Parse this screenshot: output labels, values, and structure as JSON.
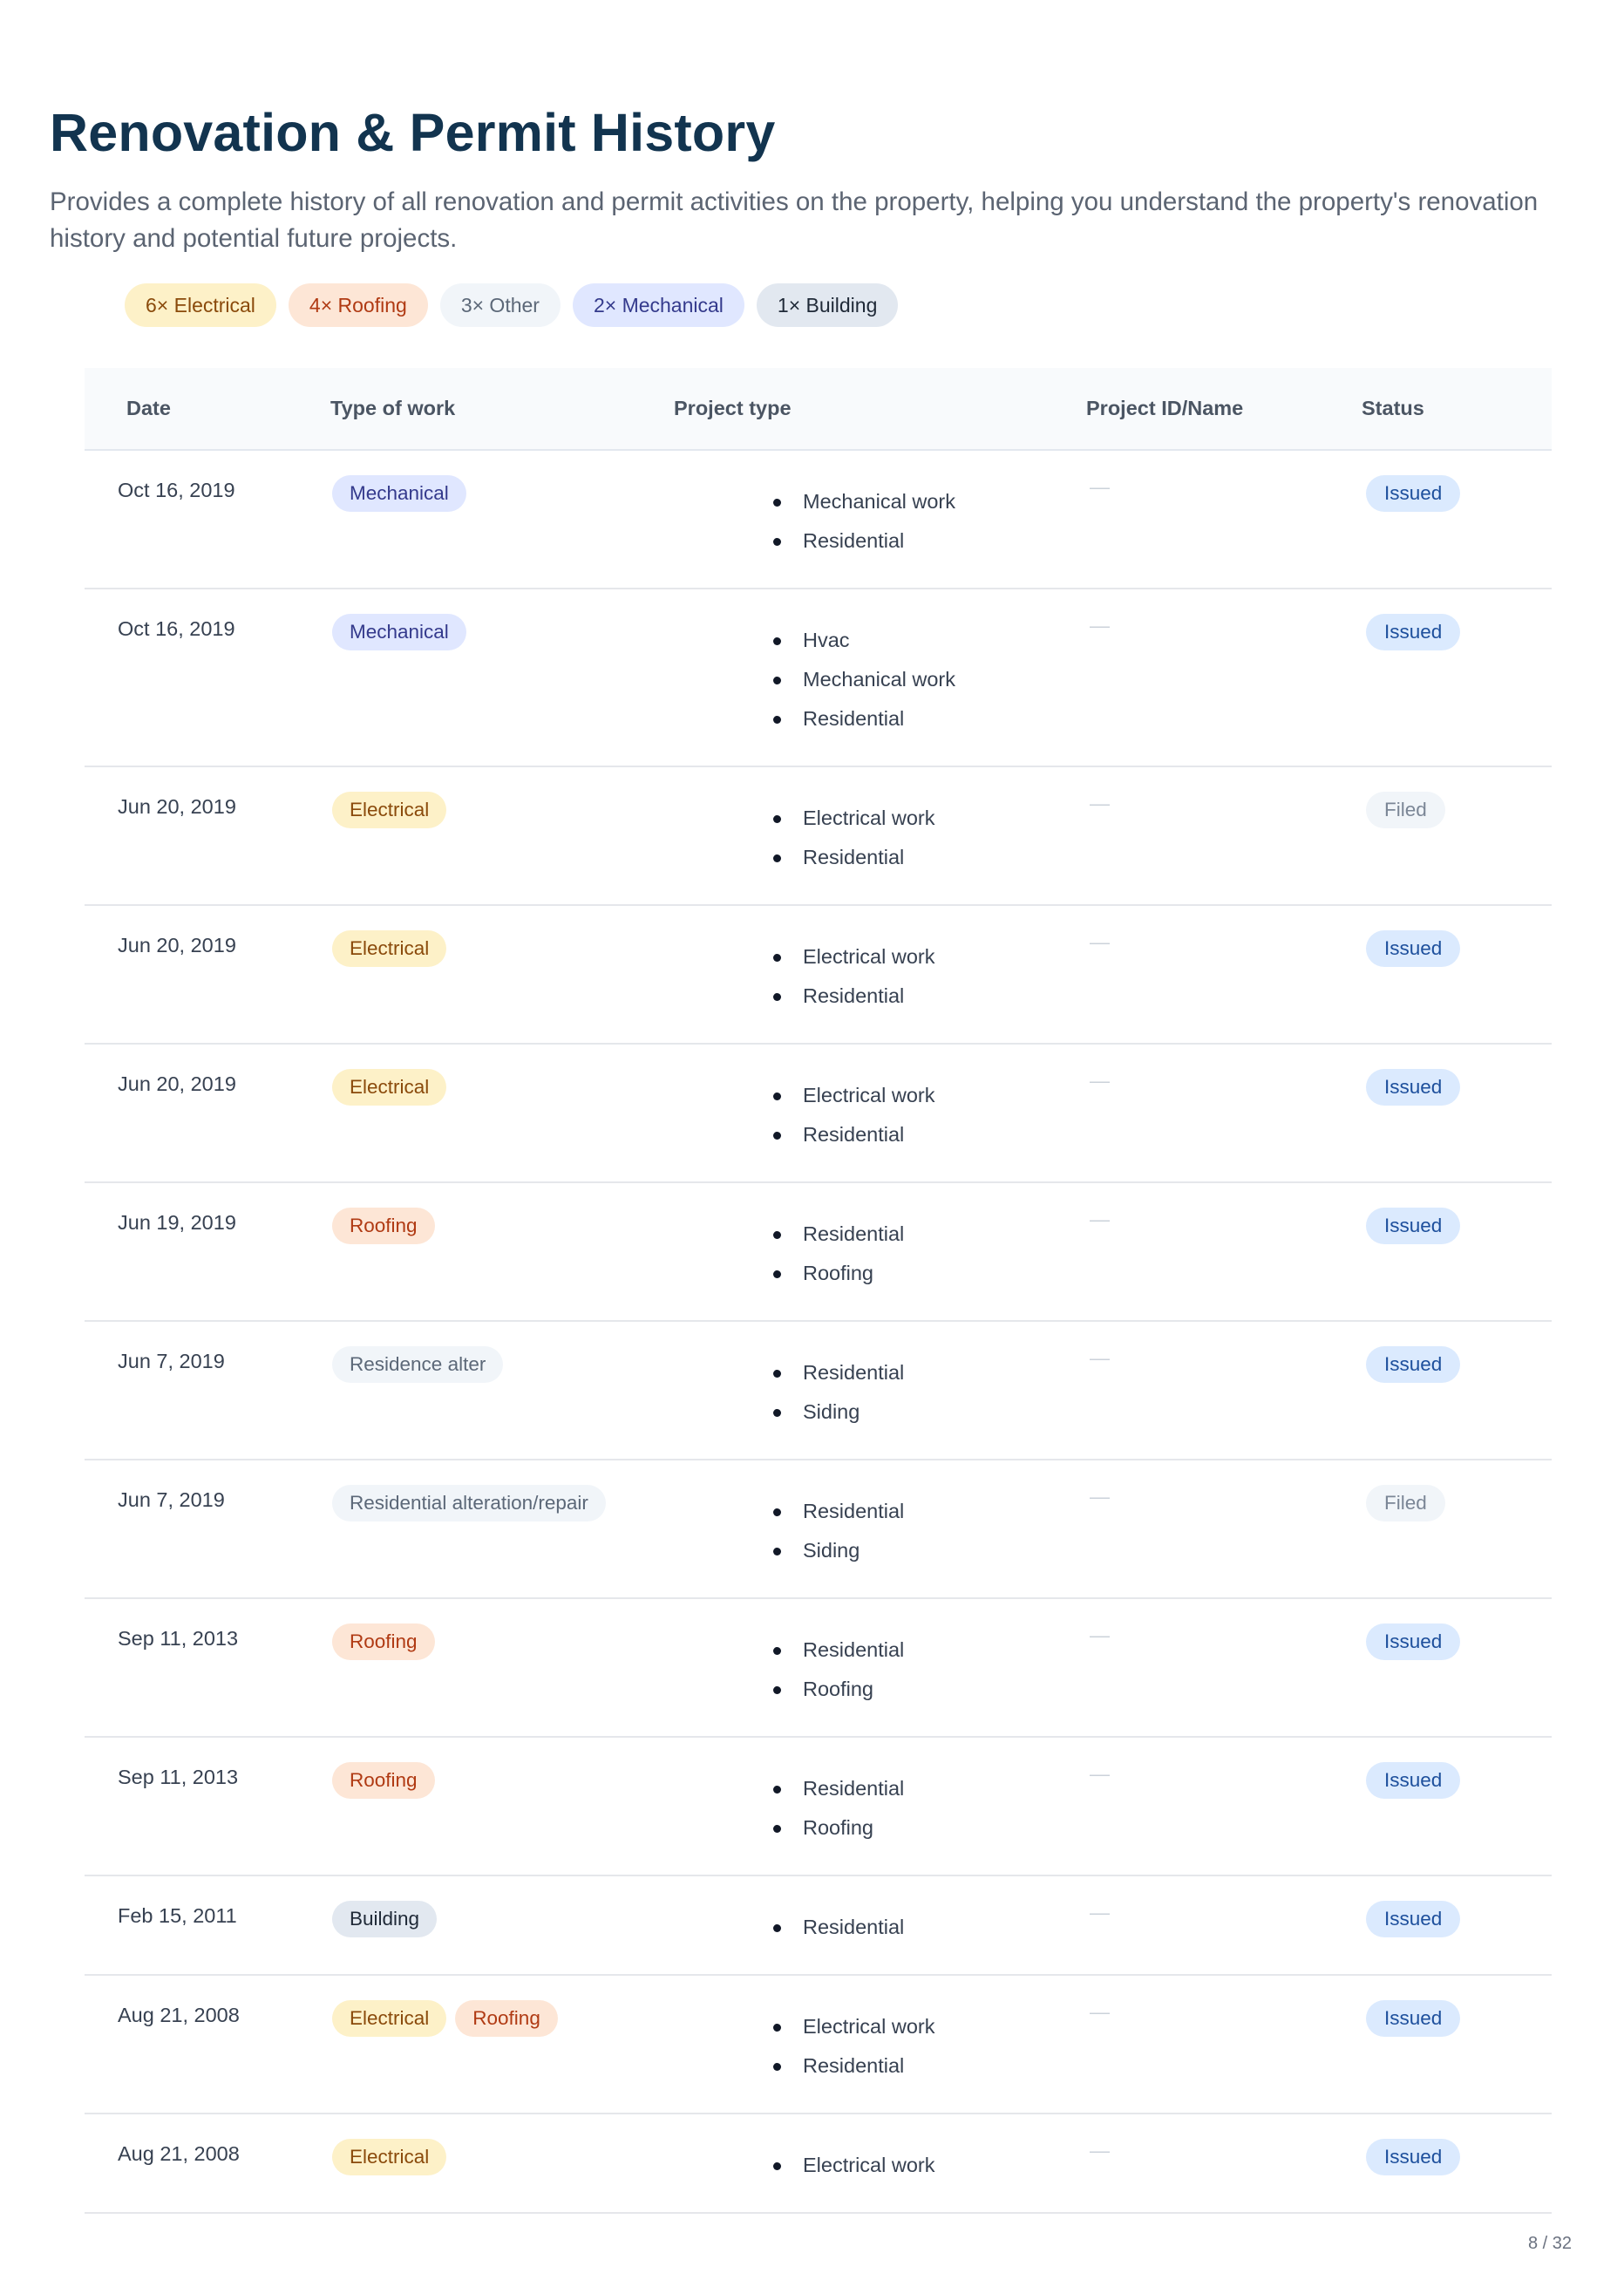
{
  "title": "Renovation & Permit History",
  "description": "Provides a complete history of all renovation and permit activities on the property, helping you understand the property's renovation history and potential future projects.",
  "summary": [
    {
      "label": "6× Electrical",
      "category": "electrical"
    },
    {
      "label": "4× Roofing",
      "category": "roofing"
    },
    {
      "label": "3× Other",
      "category": "other"
    },
    {
      "label": "2× Mechanical",
      "category": "mechanical"
    },
    {
      "label": "1× Building",
      "category": "building"
    }
  ],
  "columns": {
    "date": "Date",
    "type_of_work": "Type of work",
    "project_type": "Project type",
    "project_id": "Project ID/Name",
    "status": "Status"
  },
  "rows": [
    {
      "date": "Oct 16, 2019",
      "types": [
        {
          "label": "Mechanical",
          "category": "mechanical"
        }
      ],
      "projects": [
        "Mechanical work",
        "Residential"
      ],
      "project_id": "—",
      "status": "Issued"
    },
    {
      "date": "Oct 16, 2019",
      "types": [
        {
          "label": "Mechanical",
          "category": "mechanical"
        }
      ],
      "projects": [
        "Hvac",
        "Mechanical work",
        "Residential"
      ],
      "project_id": "—",
      "status": "Issued"
    },
    {
      "date": "Jun 20, 2019",
      "types": [
        {
          "label": "Electrical",
          "category": "electrical"
        }
      ],
      "projects": [
        "Electrical work",
        "Residential"
      ],
      "project_id": "—",
      "status": "Filed"
    },
    {
      "date": "Jun 20, 2019",
      "types": [
        {
          "label": "Electrical",
          "category": "electrical"
        }
      ],
      "projects": [
        "Electrical work",
        "Residential"
      ],
      "project_id": "—",
      "status": "Issued"
    },
    {
      "date": "Jun 20, 2019",
      "types": [
        {
          "label": "Electrical",
          "category": "electrical"
        }
      ],
      "projects": [
        "Electrical work",
        "Residential"
      ],
      "project_id": "—",
      "status": "Issued"
    },
    {
      "date": "Jun 19, 2019",
      "types": [
        {
          "label": "Roofing",
          "category": "roofing"
        }
      ],
      "projects": [
        "Residential",
        "Roofing"
      ],
      "project_id": "—",
      "status": "Issued"
    },
    {
      "date": "Jun 7, 2019",
      "types": [
        {
          "label": "Residence alter",
          "category": "other"
        }
      ],
      "projects": [
        "Residential",
        "Siding"
      ],
      "project_id": "—",
      "status": "Issued"
    },
    {
      "date": "Jun 7, 2019",
      "types": [
        {
          "label": "Residential alteration/repair",
          "category": "other"
        }
      ],
      "projects": [
        "Residential",
        "Siding"
      ],
      "project_id": "—",
      "status": "Filed"
    },
    {
      "date": "Sep 11, 2013",
      "types": [
        {
          "label": "Roofing",
          "category": "roofing"
        }
      ],
      "projects": [
        "Residential",
        "Roofing"
      ],
      "project_id": "—",
      "status": "Issued"
    },
    {
      "date": "Sep 11, 2013",
      "types": [
        {
          "label": "Roofing",
          "category": "roofing"
        }
      ],
      "projects": [
        "Residential",
        "Roofing"
      ],
      "project_id": "—",
      "status": "Issued"
    },
    {
      "date": "Feb 15, 2011",
      "types": [
        {
          "label": "Building",
          "category": "building"
        }
      ],
      "projects": [
        "Residential"
      ],
      "project_id": "—",
      "status": "Issued"
    },
    {
      "date": "Aug 21, 2008",
      "types": [
        {
          "label": "Electrical",
          "category": "electrical"
        },
        {
          "label": "Roofing",
          "category": "roofing"
        }
      ],
      "projects": [
        "Electrical work",
        "Residential"
      ],
      "project_id": "—",
      "status": "Issued"
    },
    {
      "date": "Aug 21, 2008",
      "types": [
        {
          "label": "Electrical",
          "category": "electrical"
        }
      ],
      "projects": [
        "Electrical work"
      ],
      "project_id": "—",
      "status": "Issued"
    }
  ],
  "colors": {
    "title": "#12344f",
    "electrical": "#fdf1c8",
    "roofing": "#fde6d6",
    "other": "#f1f5f9",
    "mechanical": "#e0e7ff",
    "building": "#e2e8f0",
    "issued": "#dbeafe",
    "filed": "#f1f5f9"
  },
  "page_number": "8 / 32"
}
